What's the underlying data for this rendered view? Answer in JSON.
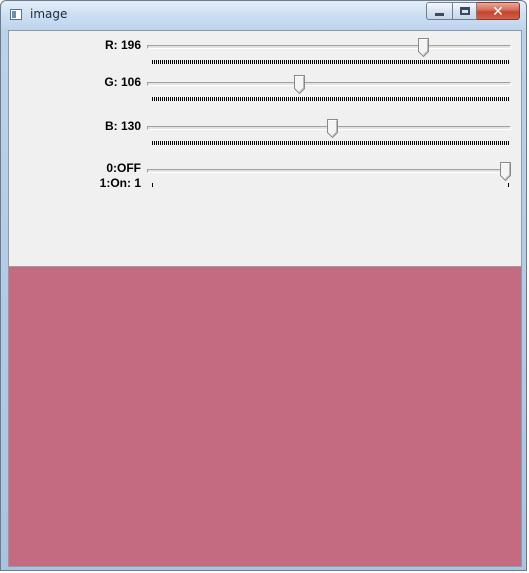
{
  "window": {
    "title": "image"
  },
  "trackbars": [
    {
      "id": "r",
      "label": "R: 196",
      "value": 196,
      "max": 255
    },
    {
      "id": "g",
      "label": "G: 106",
      "value": 106,
      "max": 255
    },
    {
      "id": "b",
      "label": "B: 130",
      "value": 130,
      "max": 255
    },
    {
      "id": "switch",
      "label_line1": "0:OFF",
      "label_line2": "1:On: 1",
      "value": 1,
      "max": 1
    }
  ],
  "image": {
    "fill_color": "#c46b82"
  }
}
